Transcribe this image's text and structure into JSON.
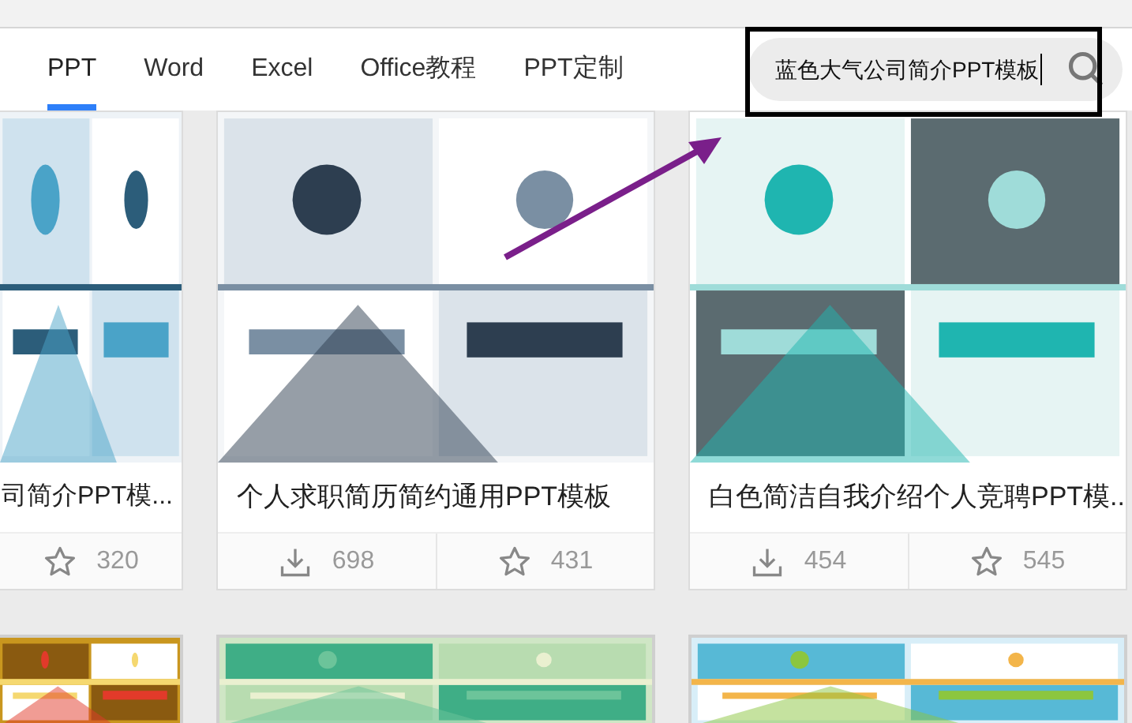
{
  "tabs": [
    {
      "label": "PPT",
      "selected": true
    },
    {
      "label": "Word",
      "selected": false
    },
    {
      "label": "Excel",
      "selected": false
    },
    {
      "label": "Office教程",
      "selected": false
    },
    {
      "label": "PPT定制",
      "selected": false
    }
  ],
  "search": {
    "value": "蓝色大气公司简介PPT模板"
  },
  "annotation": {
    "highlight_box": true,
    "arrow": true
  },
  "cards": [
    {
      "title": "司简介PPT模...",
      "favorites": "320"
    },
    {
      "title": "个人求职简历简约通用PPT模板",
      "downloads": "698",
      "favorites": "431"
    },
    {
      "title": "白色简洁自我介绍个人竞聘PPT模...",
      "downloads": "454",
      "favorites": "545"
    }
  ]
}
